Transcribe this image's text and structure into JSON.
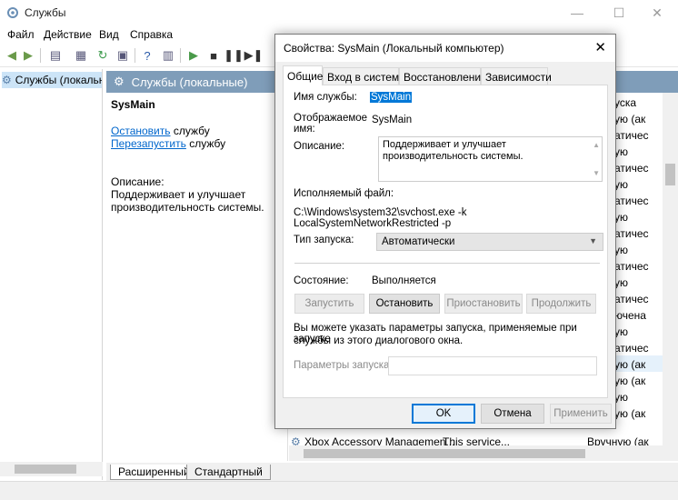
{
  "window": {
    "title": "Службы",
    "minimize_icon": "minimize-icon",
    "maximize_icon": "maximize-icon",
    "close_icon": "close-icon"
  },
  "menu": [
    "Файл",
    "Действие",
    "Вид",
    "Справка"
  ],
  "tree": {
    "root_label": "Службы (локальн"
  },
  "content": {
    "header": "Службы (локальные)",
    "service_name": "SysMain",
    "link_stop": "Остановить",
    "link_stop_suffix": " службу",
    "link_restart": "Перезапустить",
    "link_restart_suffix": " службу",
    "desc_label": "Описание:",
    "desc_line1": "Поддерживает и улучшает",
    "desc_line2": "производительность системы."
  },
  "list": {
    "status_cells": [
      "уска",
      "ую (ак",
      "атичес",
      "ую",
      "атичес",
      "ую",
      "атичес",
      "ую",
      "атичес",
      "ую",
      "атичес",
      "ую",
      "атичес",
      "ючена",
      "ую",
      "атичес",
      "ую (ак",
      "ую (ак",
      "ую",
      "ую (ак"
    ],
    "last_row": {
      "name": "Xbox Accessory Managemen...",
      "desc": "This service...",
      "startup": "Вручную (ак"
    }
  },
  "bottom_tabs": [
    "Расширенный",
    "Стандартный"
  ],
  "dialog": {
    "title": "Свойства: SysMain (Локальный компьютер)",
    "tabs": [
      "Общие",
      "Вход в систему",
      "Восстановление",
      "Зависимости"
    ],
    "service_name_label": "Имя службы:",
    "service_name_value": "SysMain",
    "display_name_label_1": "Отображаемое",
    "display_name_label_2": "имя:",
    "display_name_value": "SysMain",
    "description_label": "Описание:",
    "description_value": "Поддерживает и улучшает производительность системы.",
    "exe_label": "Исполняемый файл:",
    "exe_value": "C:\\Windows\\system32\\svchost.exe -k LocalSystemNetworkRestricted -p",
    "startup_type_label": "Тип запуска:",
    "startup_type_value": "Автоматически",
    "status_label": "Состояние:",
    "status_value": "Выполняется",
    "btn_start": "Запустить",
    "btn_stop": "Остановить",
    "btn_pause": "Приостановить",
    "btn_resume": "Продолжить",
    "hint_line1": "Вы можете указать параметры запуска, применяемые при запуске",
    "hint_line2": "службы из этого диалогового окна.",
    "params_label": "Параметры запуска:",
    "btn_ok": "OK",
    "btn_cancel": "Отмена",
    "btn_apply": "Применить"
  }
}
